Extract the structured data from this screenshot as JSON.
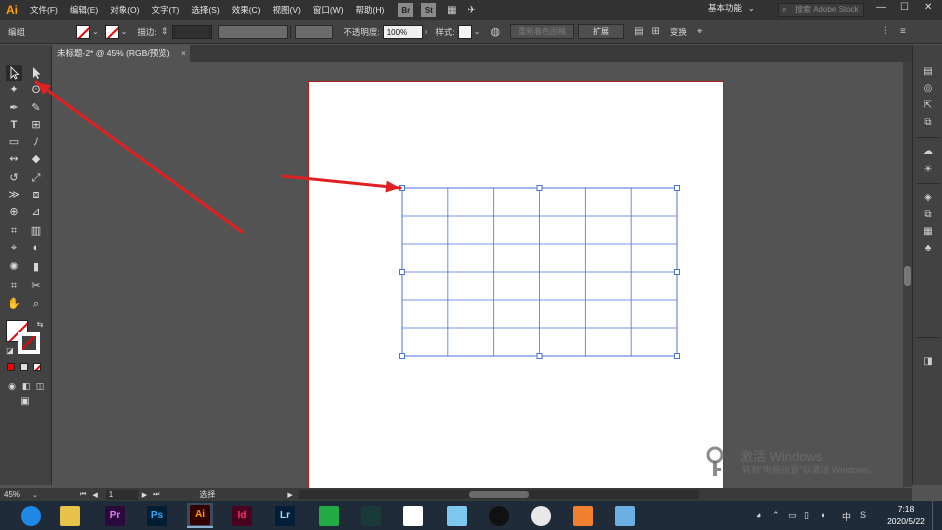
{
  "app": {
    "logo": "Ai"
  },
  "menu": [
    "文件(F)",
    "编辑(E)",
    "对象(O)",
    "文字(T)",
    "选择(S)",
    "效果(C)",
    "视图(V)",
    "窗口(W)",
    "帮助(H)"
  ],
  "menubar_badges": [
    "Br",
    "St"
  ],
  "workspace": {
    "label": "基本功能",
    "search_placeholder": "搜索 Adobe Stock"
  },
  "window_controls": {
    "minimize": "—",
    "maximize": "☐",
    "close": "✕"
  },
  "controlbar": {
    "group_label": "编组",
    "stroke_label": "描边:",
    "opacity_label": "不透明度:",
    "opacity_value": "100%",
    "style_label": "样式:",
    "recolor_label": "重新着色图稿",
    "expand_label": "扩展",
    "transform_label": "变换"
  },
  "document_tab": {
    "title": "未标题-2* @ 45% (RGB/预览)",
    "close": "×"
  },
  "tools": {
    "selection": "selection-arrow-icon",
    "direct_selection": "direct-selection-icon"
  },
  "status": {
    "zoom": "45%",
    "artboard_number": "1",
    "tool_name": "选择"
  },
  "watermark": {
    "title": "激活 Windows",
    "subtitle": "转到\"电脑设置\"以激活 Windows。"
  },
  "taskbar": {
    "apps": [
      {
        "name": "browser",
        "label": "",
        "bg": "#1e88e5",
        "fg": "#ffffff"
      },
      {
        "name": "file-explorer",
        "label": "",
        "bg": "#e8c24a",
        "fg": "#5a4400"
      },
      {
        "name": "premiere",
        "label": "Pr",
        "bg": "#2a0a3a",
        "fg": "#ea77ff"
      },
      {
        "name": "photoshop",
        "label": "Ps",
        "bg": "#001d34",
        "fg": "#31a8ff"
      },
      {
        "name": "illustrator",
        "label": "Ai",
        "bg": "#330000",
        "fg": "#ff9a00"
      },
      {
        "name": "indesign",
        "label": "Id",
        "bg": "#49021f",
        "fg": "#ff3366"
      },
      {
        "name": "lightroom",
        "label": "Lr",
        "bg": "#001e36",
        "fg": "#a8d5ff"
      },
      {
        "name": "green-app",
        "label": "",
        "bg": "#22aa44",
        "fg": "#ffffff"
      },
      {
        "name": "video-app",
        "label": "",
        "bg": "#1a3a3a",
        "fg": "#ffffff"
      },
      {
        "name": "red-app",
        "label": "",
        "bg": "#ffffff",
        "fg": "#cc2222"
      },
      {
        "name": "bird-app",
        "label": "",
        "bg": "#7ec8f0",
        "fg": "#ffffff"
      },
      {
        "name": "qq",
        "label": "",
        "bg": "#111111",
        "fg": "#ffffff"
      },
      {
        "name": "chrome",
        "label": "",
        "bg": "#e8e8e8",
        "fg": "#cc3333"
      },
      {
        "name": "orange-app",
        "label": "",
        "bg": "#f08030",
        "fg": "#ffffff"
      },
      {
        "name": "blue-app",
        "label": "",
        "bg": "#6ab0e0",
        "fg": "#ffffff"
      }
    ],
    "tray_lang": "中",
    "clock_time": "7:18",
    "clock_date": "2020/5/22"
  },
  "colors": {
    "accent_red": "#e02020",
    "grid_blue": "#4a72d8",
    "artboard_border": "#b02020"
  }
}
